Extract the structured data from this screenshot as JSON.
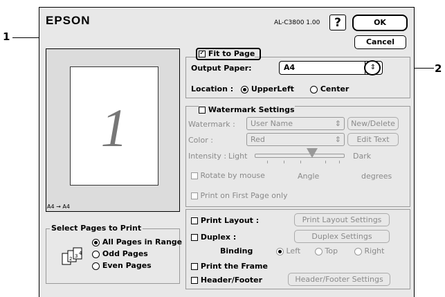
{
  "header": {
    "brand": "EPSON",
    "version": "AL-C3800 1.00",
    "help": "?",
    "ok": "OK",
    "cancel": "Cancel"
  },
  "preview": {
    "page_number": "1",
    "size_label": "A4 → A4"
  },
  "select_pages": {
    "title": "Select Pages to Print",
    "options": [
      "All Pages in Range",
      "Odd Pages",
      "Even Pages"
    ],
    "selected": "All Pages in Range"
  },
  "fit_to_page": {
    "label": "Fit to Page",
    "checked": true,
    "output_paper_label": "Output Paper:",
    "output_paper_value": "A4",
    "location_label": "Location :",
    "location_options": [
      "UpperLeft",
      "Center"
    ],
    "location_selected": "UpperLeft"
  },
  "watermark": {
    "title": "Watermark Settings",
    "checked": false,
    "watermark_label": "Watermark :",
    "watermark_value": "User Name",
    "new_delete": "New/Delete",
    "color_label": "Color :",
    "color_value": "Red",
    "edit_text": "Edit Text",
    "intensity_label": "Intensity :",
    "light": "Light",
    "dark": "Dark",
    "intensity_level": 0.65,
    "rotate_label": "Rotate by mouse",
    "angle_label": "Angle",
    "degrees_label": "degrees",
    "first_page_label": "Print on First Page only"
  },
  "layout": {
    "print_layout_label": "Print Layout :",
    "print_layout_settings": "Print Layout Settings",
    "duplex_label": "Duplex :",
    "duplex_settings": "Duplex Settings",
    "binding_label": "Binding",
    "binding_options": [
      "Left",
      "Top",
      "Right"
    ],
    "binding_selected": "Left",
    "print_frame_label": "Print the Frame",
    "header_footer_label": "Header/Footer",
    "header_footer_settings": "Header/Footer Settings"
  },
  "callouts": [
    "1",
    "2"
  ]
}
